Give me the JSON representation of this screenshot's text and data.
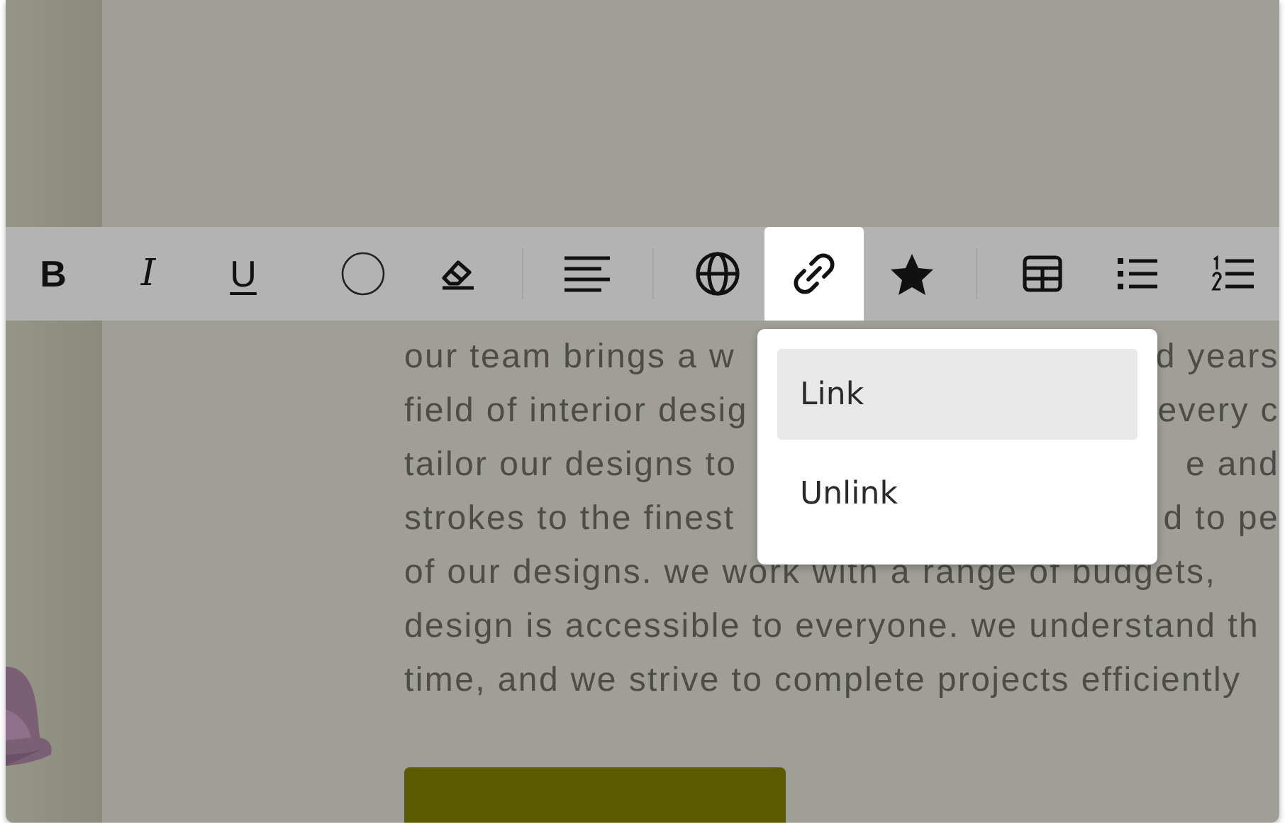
{
  "paragraph_lines": [
    {
      "left": "our team brings a w",
      "right": "d years"
    },
    {
      "left": "field of interior desig",
      "right": "every c"
    },
    {
      "left": "tailor our designs to",
      "right": "e and"
    },
    {
      "left": "strokes to the finest",
      "right": "d to pe"
    },
    {
      "left": "of our designs. we work with a range of budgets,"
    },
    {
      "left": "design is accessible to everyone. we understand th"
    },
    {
      "left": "time, and we strive to complete projects efficiently"
    }
  ],
  "toolbar": {
    "groups": [
      {
        "tools": [
          {
            "kind": "bold",
            "label": "B",
            "selected": false
          },
          {
            "kind": "italic",
            "label": "I",
            "selected": false
          },
          {
            "kind": "underline",
            "label": "U",
            "selected": false
          },
          {
            "kind": "color",
            "selected": false
          },
          {
            "kind": "eraser",
            "selected": false
          }
        ]
      },
      {
        "tools": [
          {
            "kind": "align",
            "selected": false
          }
        ]
      },
      {
        "tools": [
          {
            "kind": "globe",
            "selected": false
          },
          {
            "kind": "link",
            "selected": true
          },
          {
            "kind": "star",
            "selected": false
          }
        ]
      },
      {
        "tools": [
          {
            "kind": "table",
            "selected": false
          },
          {
            "kind": "bullets",
            "selected": false
          },
          {
            "kind": "numbers",
            "selected": false
          }
        ]
      }
    ]
  },
  "link_menu": {
    "items": [
      {
        "label": "Link",
        "selected": true
      },
      {
        "label": "Unlink",
        "selected": false
      }
    ]
  }
}
